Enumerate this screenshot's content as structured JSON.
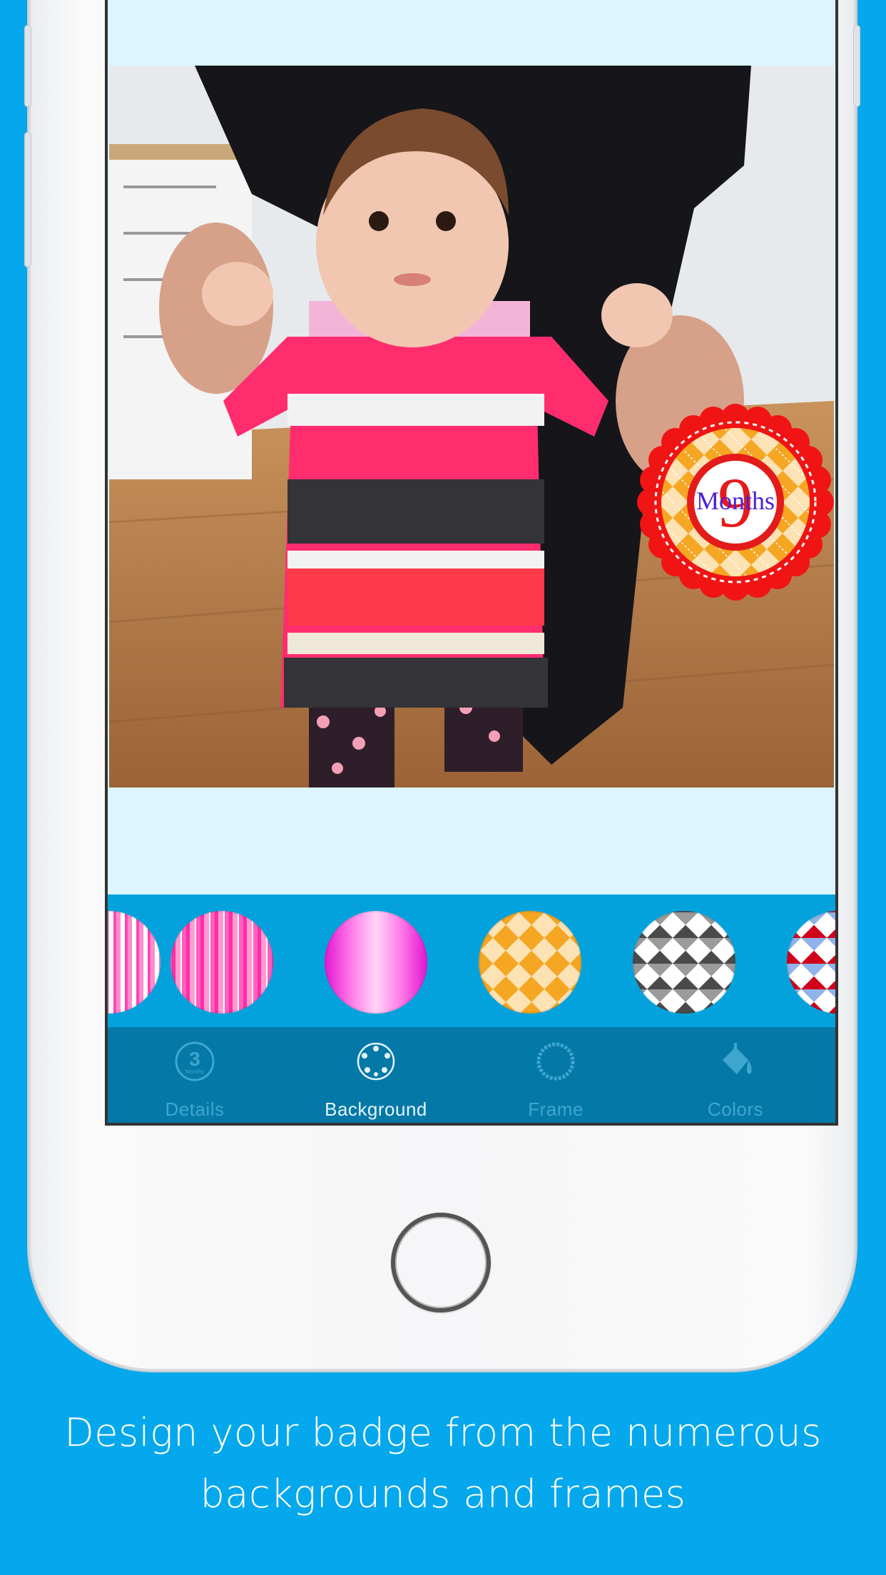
{
  "caption": {
    "line1": "Design your badge from the numerous",
    "line2": "backgrounds and frames"
  },
  "badge": {
    "number": "9",
    "label": "Months",
    "colors": {
      "outer": "#f01414",
      "pattern_a": "#f5a623",
      "pattern_b": "#fde2b3",
      "ring": "#e41b1b",
      "text": "#4b1fd8"
    }
  },
  "backgrounds": [
    {
      "name": "pink-stripes-partial",
      "colors": [
        "#ff8ccf",
        "#ffffff"
      ]
    },
    {
      "name": "pink-stripes",
      "colors": [
        "#ff2ea6",
        "#ff9ad3"
      ]
    },
    {
      "name": "magenta-gradient-stripes",
      "colors": [
        "#e31bd4",
        "#ffd5f6"
      ]
    },
    {
      "name": "orange-argyle",
      "colors": [
        "#f5a623",
        "#fde2b3"
      ]
    },
    {
      "name": "gray-argyle",
      "colors": [
        "#4a4a4a",
        "#ffffff"
      ]
    },
    {
      "name": "red-blue-argyle",
      "colors": [
        "#d0021b",
        "#8fb3ea"
      ]
    }
  ],
  "tabs": [
    {
      "label": "Details",
      "icon": "badge-3-months-icon",
      "active": false
    },
    {
      "label": "Background",
      "icon": "star-circle-icon",
      "active": true
    },
    {
      "label": "Frame",
      "icon": "scalloped-ring-icon",
      "active": false
    },
    {
      "label": "Colors",
      "icon": "paint-bucket-icon",
      "active": false
    }
  ],
  "details_icon": {
    "number": "3",
    "label": "Months"
  },
  "colors": {
    "page_background": "#05a8ec",
    "tab_bar": "#0479a8",
    "swatch_strip": "#04a2dd",
    "tab_active": "#e6f4fb",
    "tab_inactive": "#3fa6cf"
  }
}
